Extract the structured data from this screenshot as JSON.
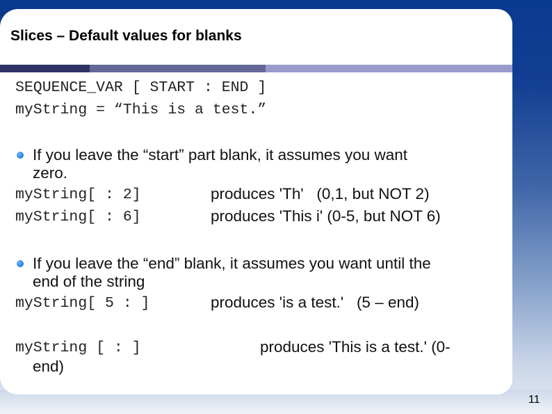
{
  "slide": {
    "title": "Slices – Default values for blanks",
    "page_number": "11",
    "accent_colors": {
      "top_band": "#0a3a8e",
      "stripe_dark": "#2f3264",
      "stripe_mid": "#646796",
      "stripe_light": "#9a9bcb",
      "bullet": "#2a86e0"
    }
  },
  "syntax": {
    "line1": "SEQUENCE_VAR [ START : END ]",
    "line2": "myString = “This is a test.”"
  },
  "sections": [
    {
      "bullet_line1": "If you leave the “start” part blank, it assumes you want",
      "bullet_line2": "zero.",
      "examples": [
        {
          "code": "myString[ : 2]",
          "result": "produces 'Th'   (0,1, but NOT 2)"
        },
        {
          "code": "myString[ : 6]",
          "result": "produces 'This i' (0-5, but NOT 6)"
        }
      ]
    },
    {
      "bullet_line1": "If you leave the “end” blank, it assumes you want until the",
      "bullet_line2": "end of the string",
      "examples": [
        {
          "code": "myString[ 5 : ]",
          "result": "produces 'is a test.'   (5 – end)"
        }
      ]
    }
  ],
  "final_example": {
    "code": "myString [ : ]",
    "result": "produces 'This is a test.' (0-",
    "continuation": "end)"
  }
}
